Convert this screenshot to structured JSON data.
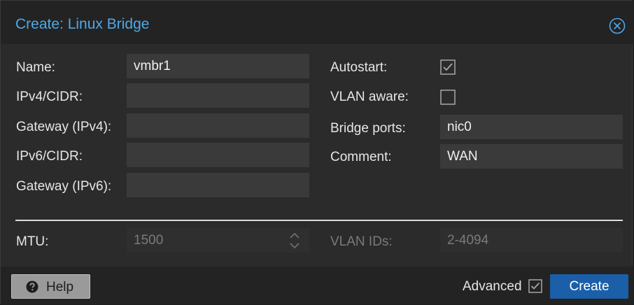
{
  "dialog": {
    "title": "Create: Linux Bridge",
    "close_icon": "close-circle-icon"
  },
  "left_fields": {
    "name": {
      "label": "Name:",
      "value": "vmbr1"
    },
    "ipv4_cidr": {
      "label": "IPv4/CIDR:",
      "value": ""
    },
    "gateway_ipv4": {
      "label": "Gateway (IPv4):",
      "value": ""
    },
    "ipv6_cidr": {
      "label": "IPv6/CIDR:",
      "value": ""
    },
    "gateway_ipv6": {
      "label": "Gateway (IPv6):",
      "value": ""
    }
  },
  "right_fields": {
    "autostart": {
      "label": "Autostart:",
      "checked": true
    },
    "vlan_aware": {
      "label": "VLAN aware:",
      "checked": false
    },
    "bridge_ports": {
      "label": "Bridge ports:",
      "value": "nic0"
    },
    "comment": {
      "label": "Comment:",
      "value": "WAN"
    }
  },
  "advanced_fields": {
    "mtu": {
      "label": "MTU:",
      "placeholder": "1500"
    },
    "vlan_ids": {
      "label": "VLAN IDs:",
      "placeholder": "2-4094"
    }
  },
  "footer": {
    "help_label": "Help",
    "help_icon": "question-circle-icon",
    "advanced_label": "Advanced",
    "advanced_checked": true,
    "create_label": "Create"
  },
  "colors": {
    "accent": "#4fa8e8",
    "primary_button": "#1a5fa8",
    "dialog_background": "#2b2b2b"
  }
}
